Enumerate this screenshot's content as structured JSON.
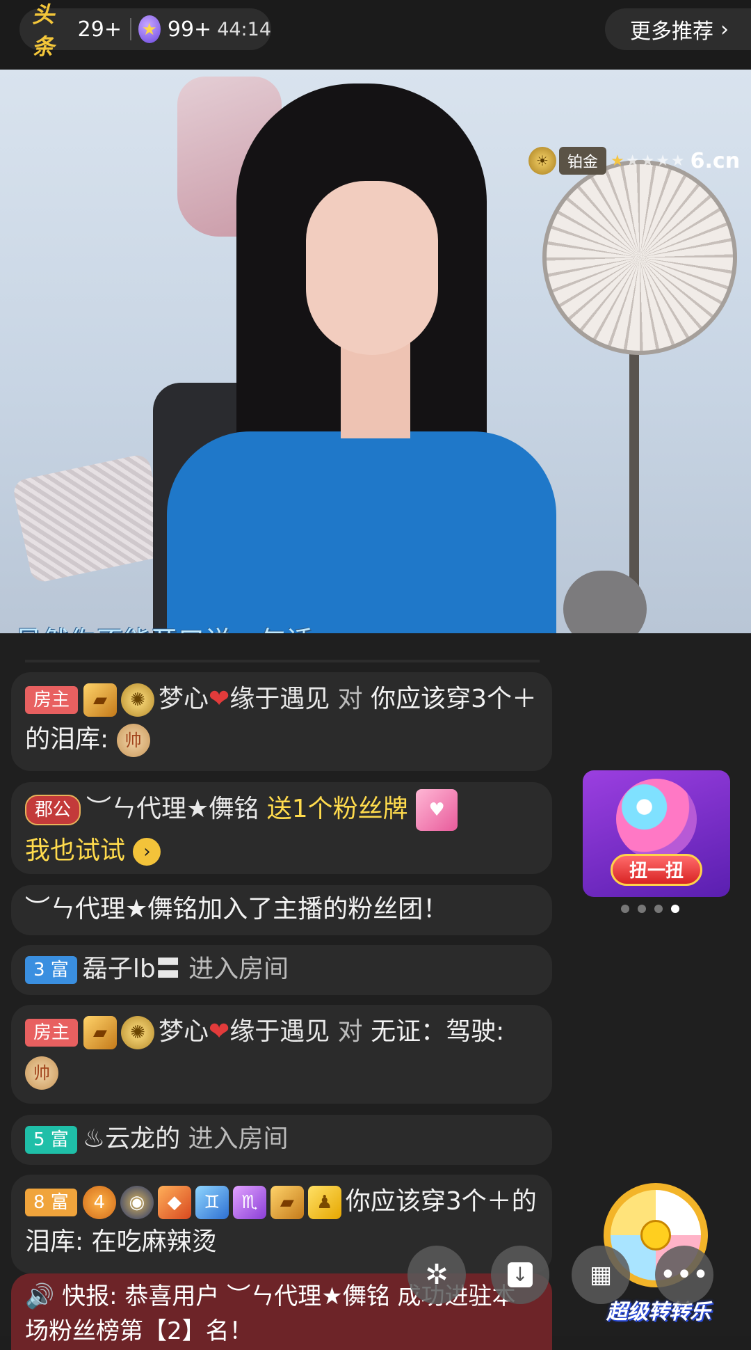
{
  "topbar": {
    "logo_text": "头条",
    "count_1": "29+",
    "count_2": "99+",
    "timer": "44:14",
    "more_label": "更多推荐",
    "more_chevron": "›"
  },
  "video": {
    "subtitle": "虽然你不能开口说一句话",
    "badge_label": "铂金",
    "watermark": "6.cn",
    "stars_filled": 1,
    "stars_total": 5
  },
  "chat": [
    {
      "tag": "房主",
      "user": "梦心",
      "user_suffix": "缘于遇见",
      "connector": "对",
      "text": "你应该穿3个＋的泪库:",
      "coin": "帅"
    },
    {
      "tag": "郡公",
      "user": "︶ㄣ代理★儛铭",
      "action": "送1个粉丝牌",
      "text": "我也试试"
    },
    {
      "text": "︶ㄣ代理★儛铭加入了主播的粉丝团！"
    },
    {
      "tag": "3 富",
      "user": "磊子lb〓",
      "text": "进入房间"
    },
    {
      "tag": "房主",
      "user": "梦心",
      "user_suffix": "缘于遇见",
      "connector": "对",
      "text": "无证：驾驶:",
      "coin": "帅"
    },
    {
      "tag": "5 富",
      "user": "♨云龙的",
      "text": "进入房间"
    },
    {
      "tag": "8 富",
      "text": "你应该穿3个＋的泪库: 在吃麻辣烫"
    }
  ],
  "news": {
    "icon": "🔊",
    "text": "快报: 恭喜用户 ︶ㄣ代理★儛铭 成功进驻本场粉丝榜第【2】名！"
  },
  "promo": {
    "button_label": "扭一扭",
    "dots_total": 4,
    "dots_active": 4
  },
  "wheel": {
    "label": "超级转转乐"
  },
  "colors": {
    "host_tag": "#e86060",
    "highlight": "#ffdb4d",
    "news_bg": "#6d2428"
  }
}
